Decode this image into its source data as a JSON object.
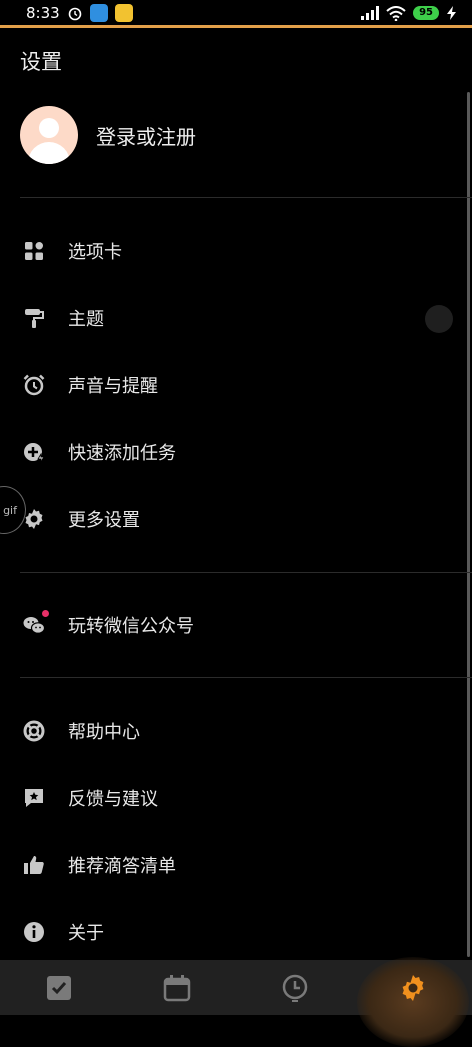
{
  "status_bar": {
    "time": "8:33",
    "battery": "95"
  },
  "page_title": "设置",
  "profile": {
    "login_label": "登录或注册"
  },
  "menu_group1": [
    {
      "label": "选项卡",
      "icon": "grid-icon"
    },
    {
      "label": "主题",
      "icon": "paint-roller-icon"
    },
    {
      "label": "声音与提醒",
      "icon": "alarm-clock-icon"
    },
    {
      "label": "快速添加任务",
      "icon": "quick-add-icon"
    },
    {
      "label": "更多设置",
      "icon": "gear-icon"
    }
  ],
  "menu_group2": [
    {
      "label": "玩转微信公众号",
      "icon": "wechat-icon"
    }
  ],
  "menu_group3": [
    {
      "label": "帮助中心",
      "icon": "lifebuoy-icon"
    },
    {
      "label": "反馈与建议",
      "icon": "feedback-icon"
    },
    {
      "label": "推荐滴答清单",
      "icon": "thumbs-up-icon"
    },
    {
      "label": "关于",
      "icon": "info-icon"
    }
  ],
  "gif_badge": "gif",
  "bottom_nav": [
    {
      "name": "tasks",
      "icon": "checkbox-icon"
    },
    {
      "name": "calendar",
      "icon": "calendar-icon"
    },
    {
      "name": "pomodoro",
      "icon": "clock-icon"
    },
    {
      "name": "settings",
      "icon": "gear-icon",
      "active": true
    }
  ],
  "colors": {
    "accent": "#f0901e",
    "background": "#000000",
    "nav_bg": "#212121",
    "icon_gray": "#c8c8c8",
    "dot_red": "#e83068"
  }
}
